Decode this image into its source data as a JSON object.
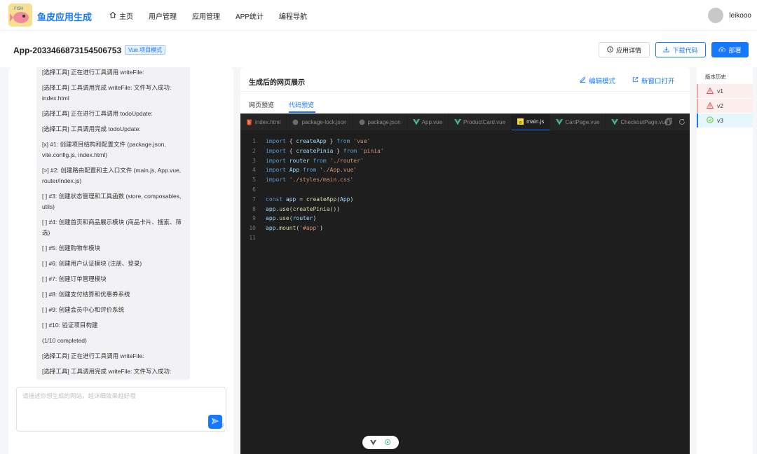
{
  "nav": {
    "brand": "鱼皮应用生成",
    "items": [
      {
        "label": "主页",
        "icon": "home-icon"
      },
      {
        "label": "用户管理"
      },
      {
        "label": "应用管理"
      },
      {
        "label": "APP统计"
      },
      {
        "label": "编程导航"
      }
    ],
    "username": "leikooo"
  },
  "app": {
    "title": "App-2033466873154506753",
    "mode_badge": "Vue 项目模式",
    "btn_details": "应用详情",
    "btn_download": "下载代码",
    "btn_deploy": "部署"
  },
  "chat": {
    "messages": [
      "[选择工具] 正在进行工具调用 writeFile:",
      "[选择工具] 工具调用完成 writeFile: 文件写入成功: index.html",
      "[选择工具] 正在进行工具调用 todoUpdate:",
      "[选择工具] 工具调用完成 todoUpdate:",
      "[x] #1: 创建项目结构和配置文件 (package.json, vite.config.js, index.html)",
      "[>] #2: 创建路由配置和主入口文件 (main.js, App.vue, router/index.js)",
      "[ ] #3: 创建状态管理和工具函数 (store, composables, utils)",
      "[ ] #4: 创建首页和商品展示模块 (商品卡片、搜索、筛选)",
      "[ ] #5: 创建购物车模块",
      "[ ] #6: 创建用户认证模块 (注册、登录)",
      "[ ] #7: 创建订单管理模块",
      "[ ] #8: 创建支付结算和优惠券系统",
      "[ ] #9: 创建会员中心和评价系统",
      "[ ] #10: 验证项目构建",
      "(1/10 completed)",
      "[选择工具] 正在进行工具调用 writeFile:",
      "[选择工具] 工具调用完成 writeFile: 文件写入成功: src/main.js"
    ],
    "input_placeholder": "请描述你想生成的网站，越详细效果越好哦"
  },
  "preview": {
    "title": "生成后的网页展示",
    "edit_mode": "编辑模式",
    "open_new": "新窗口打开",
    "tabs": [
      "网页预览",
      "代码预览"
    ],
    "active_tab": "代码预览"
  },
  "editor": {
    "files": [
      {
        "name": "index.html",
        "icon": "html5-icon",
        "color": "#e44d26"
      },
      {
        "name": "package-lock.json",
        "icon": "json-icon",
        "color": "#6b6b6b"
      },
      {
        "name": "package.json",
        "icon": "json-icon",
        "color": "#6b6b6b"
      },
      {
        "name": "App.vue",
        "icon": "vue-icon",
        "color": "#42b883"
      },
      {
        "name": "ProductCard.vue",
        "icon": "vue-icon",
        "color": "#42b883"
      },
      {
        "name": "main.js",
        "icon": "js-icon",
        "color": "#f1dd35",
        "active": true
      },
      {
        "name": "CartPage.vue",
        "icon": "vue-icon",
        "color": "#42b883"
      },
      {
        "name": "CheckoutPage.vue",
        "icon": "vue-icon",
        "color": "#42b883"
      }
    ],
    "lines": [
      [
        [
          "kw",
          "import"
        ],
        [
          "src",
          " { "
        ],
        [
          "id",
          "createApp"
        ],
        [
          "src",
          " } "
        ],
        [
          "kw",
          "from"
        ],
        [
          "src",
          " "
        ],
        [
          "str",
          "'vue'"
        ]
      ],
      [
        [
          "kw",
          "import"
        ],
        [
          "src",
          " { "
        ],
        [
          "id",
          "createPinia"
        ],
        [
          "src",
          " } "
        ],
        [
          "kw",
          "from"
        ],
        [
          "src",
          " "
        ],
        [
          "str",
          "'pinia'"
        ]
      ],
      [
        [
          "kw",
          "import"
        ],
        [
          "src",
          " "
        ],
        [
          "id",
          "router"
        ],
        [
          "src",
          " "
        ],
        [
          "kw",
          "from"
        ],
        [
          "src",
          " "
        ],
        [
          "str",
          "'./router'"
        ]
      ],
      [
        [
          "kw",
          "import"
        ],
        [
          "src",
          " "
        ],
        [
          "id",
          "App"
        ],
        [
          "src",
          " "
        ],
        [
          "kw",
          "from"
        ],
        [
          "src",
          " "
        ],
        [
          "str",
          "'./App.vue'"
        ]
      ],
      [
        [
          "kw",
          "import"
        ],
        [
          "src",
          " "
        ],
        [
          "str",
          "'./styles/main.css'"
        ]
      ],
      [],
      [
        [
          "kw",
          "const"
        ],
        [
          "src",
          " "
        ],
        [
          "id",
          "app"
        ],
        [
          "src",
          " = "
        ],
        [
          "fn",
          "createApp"
        ],
        [
          "src",
          "("
        ],
        [
          "id",
          "App"
        ],
        [
          "src",
          ")"
        ]
      ],
      [
        [
          "id",
          "app"
        ],
        [
          "src",
          "."
        ],
        [
          "fn",
          "use"
        ],
        [
          "src",
          "("
        ],
        [
          "fn",
          "createPinia"
        ],
        [
          "src",
          "())"
        ]
      ],
      [
        [
          "id",
          "app"
        ],
        [
          "src",
          "."
        ],
        [
          "fn",
          "use"
        ],
        [
          "src",
          "("
        ],
        [
          "id",
          "router"
        ],
        [
          "src",
          ")"
        ]
      ],
      [
        [
          "id",
          "app"
        ],
        [
          "src",
          "."
        ],
        [
          "fn",
          "mount"
        ],
        [
          "src",
          "("
        ],
        [
          "str",
          "'#app'"
        ],
        [
          "src",
          ")"
        ]
      ],
      []
    ]
  },
  "versions": {
    "title": "版本历史",
    "items": [
      {
        "label": "v1",
        "status": "error"
      },
      {
        "label": "v2",
        "status": "error"
      },
      {
        "label": "v3",
        "status": "success"
      }
    ]
  },
  "colors": {
    "accent": "#1677ff",
    "error": "#e5484d",
    "success": "#52c41a"
  }
}
